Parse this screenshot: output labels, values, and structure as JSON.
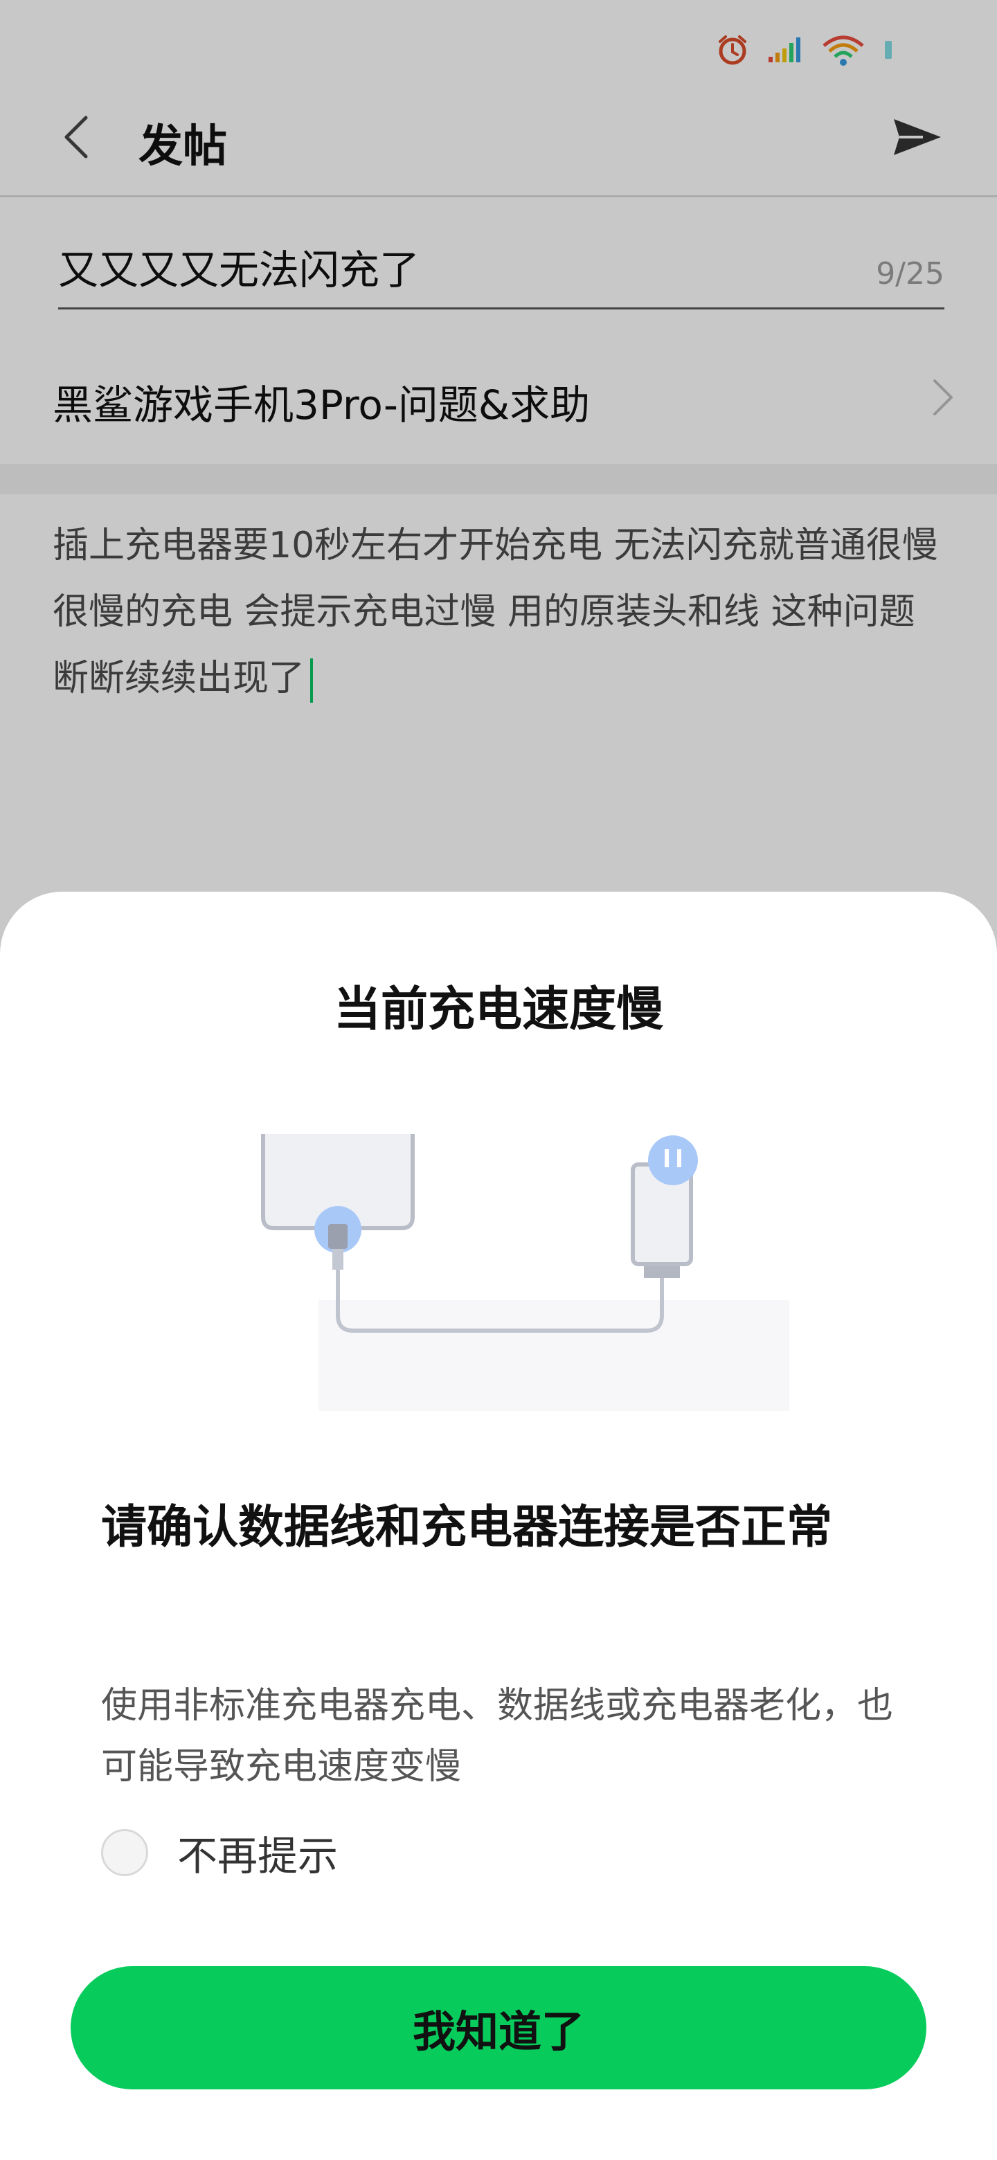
{
  "status_bar": {
    "icons": [
      "alarm-icon",
      "signal-icon",
      "wifi-icon",
      "battery-icon"
    ]
  },
  "header": {
    "title": "发帖",
    "back_icon": "chevron-left-icon",
    "send_icon": "send-icon"
  },
  "post": {
    "title_value": "又又又又无法闪充了",
    "char_count": "9/25",
    "forum": "黑鲨游戏手机3Pro-问题&求助",
    "content": "插上充电器要10秒左右才开始充电 无法闪充就普通很慢很慢的充电 会提示充电过慢 用的原装头和线 这种问题断断续续出现了"
  },
  "dialog": {
    "title": "当前充电速度慢",
    "prompt_title": "请确认数据线和充电器连接是否正常",
    "prompt_desc": "使用非标准充电器充电、数据线或充电器老化，也可能导致充电速度变慢",
    "no_remind_label": "不再提示",
    "no_remind_checked": false,
    "ok_label": "我知道了"
  },
  "colors": {
    "accent": "#07cc5c",
    "caret": "#07c160",
    "illustration_blue": "#a8c8f8"
  }
}
